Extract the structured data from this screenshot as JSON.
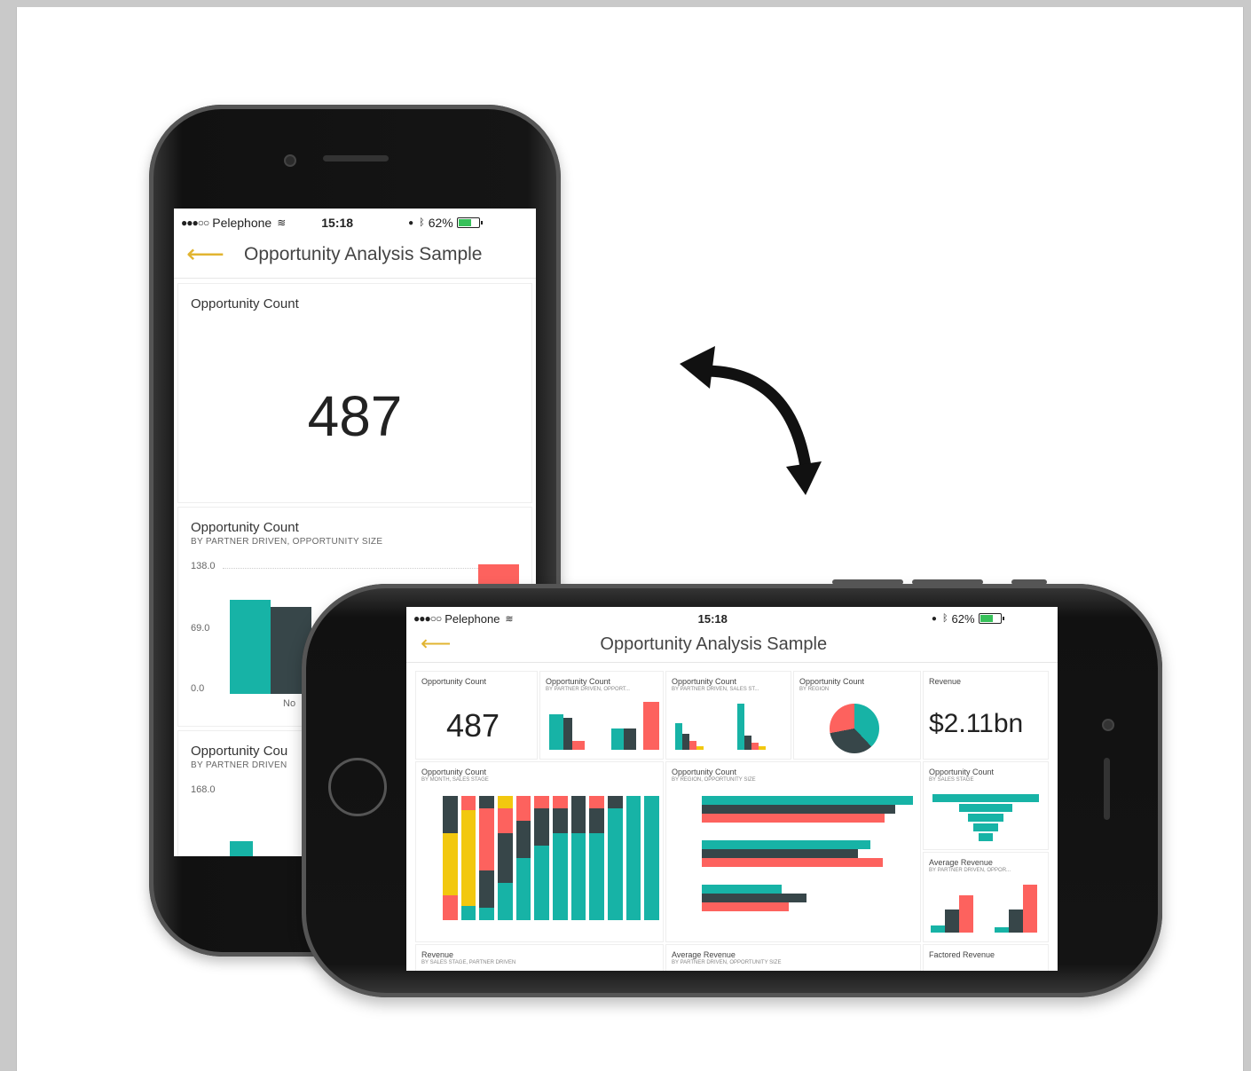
{
  "colors": {
    "teal": "#17b3a6",
    "dark": "#374649",
    "red": "#fd625e",
    "yellow": "#f2c80f",
    "accent": "#e1b431"
  },
  "status": {
    "carrier": "Pelephone",
    "time": "15:18",
    "battery": "62%",
    "signal_dots": "●●●○○"
  },
  "icons": {
    "back": "back-arrow-icon",
    "rotate": "rotate-arrow-icon"
  },
  "app": {
    "title": "Opportunity Analysis Sample",
    "back_glyph": "⟵"
  },
  "portrait": {
    "tile1": {
      "title": "Opportunity Count",
      "value": "487"
    },
    "tile2": {
      "title": "Opportunity Count",
      "subtitle": "BY PARTNER DRIVEN, OPPORTUNITY SIZE",
      "ticks": [
        "138.0",
        "69.0",
        "0.0"
      ],
      "xlabel": "No"
    },
    "tile3": {
      "title": "Opportunity Cou",
      "subtitle": "BY PARTNER DRIVEN",
      "tick": "168.0"
    }
  },
  "landscape": {
    "tiles": [
      {
        "title": "Opportunity Count",
        "value": "487"
      },
      {
        "title": "Opportunity Count",
        "subtitle": "BY PARTNER DRIVEN, OPPORT..."
      },
      {
        "title": "Opportunity Count",
        "subtitle": "BY PARTNER DRIVEN, SALES ST..."
      },
      {
        "title": "Opportunity Count",
        "subtitle": "BY REGION"
      },
      {
        "title": "Revenue",
        "value": "$2.11bn"
      },
      {
        "title": "Opportunity Count",
        "subtitle": "BY MONTH, SALES STAGE"
      },
      {
        "title": "Opportunity Count",
        "subtitle": "BY REGION, OPPORTUNITY SIZE"
      },
      {
        "title": "Opportunity Count",
        "subtitle": "BY SALES STAGE"
      },
      {
        "title": "Average Revenue",
        "subtitle": "BY PARTNER DRIVEN, OPPOR..."
      },
      {
        "title": "Revenue",
        "subtitle": "BY SALES STAGE, PARTNER DRIVEN"
      },
      {
        "title": "Average Revenue",
        "subtitle": "BY PARTNER DRIVEN, OPPORTUNITY SIZE"
      },
      {
        "title": "Factored Revenue"
      }
    ]
  }
}
